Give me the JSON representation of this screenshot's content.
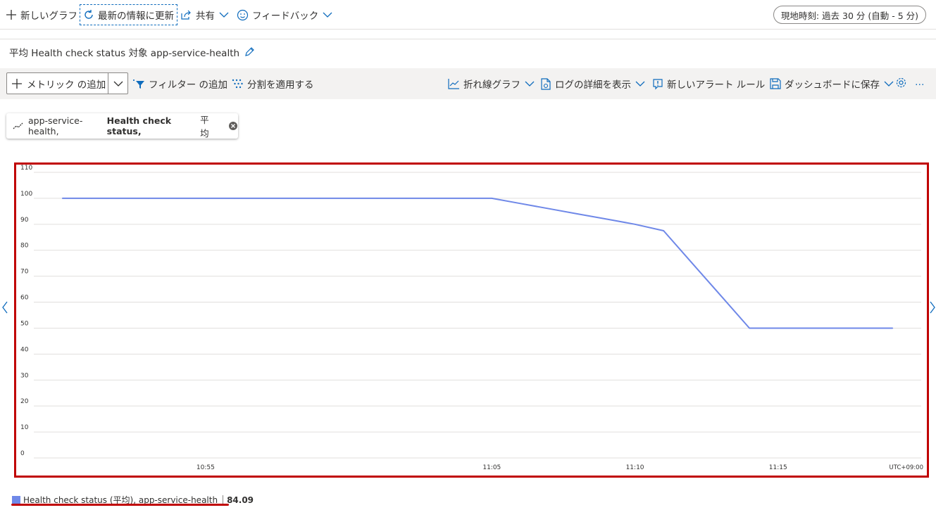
{
  "command_bar": {
    "new_chart": "新しいグラフ",
    "refresh": "最新の情報に更新",
    "share": "共有",
    "feedback": "フィードバック",
    "time_range": "現地時刻: 過去 30 分 (自動 - 5 分)"
  },
  "chart_title": "平均 Health check status 対象 app-service-health",
  "toolbar": {
    "add_metric": "メトリック の追加",
    "add_filter": "フィルター の追加",
    "apply_split": "分割を適用する",
    "line_chart": "折れ線グラフ",
    "show_log_details": "ログの詳細を表示",
    "new_alert_rule": "新しいアラート ルール",
    "save_to_dashboard": "ダッシュボードに保存",
    "more": "…"
  },
  "metric_pill": {
    "resource": "app-service-health,",
    "metric": "Health check status,",
    "aggregation": "平均"
  },
  "legend": {
    "label": "Health check status (平均), app-service-health",
    "value": "84.09"
  },
  "colors": {
    "series": "#6f88e8",
    "highlight": "#c00000",
    "accent": "#0f6cbd"
  },
  "chart_data": {
    "type": "line",
    "timezone_label": "UTC+09:00",
    "x_ticks": [
      "10:55",
      "11:05",
      "11:10",
      "11:15"
    ],
    "ylim": [
      0,
      110
    ],
    "y_ticks": [
      0,
      10,
      20,
      30,
      40,
      50,
      60,
      70,
      80,
      90,
      100,
      110
    ],
    "series": [
      {
        "name": "Health check status (平均), app-service-health",
        "x": [
          "10:50",
          "10:51",
          "10:52",
          "10:53",
          "10:54",
          "10:55",
          "10:56",
          "10:57",
          "10:58",
          "10:59",
          "11:00",
          "11:01",
          "11:02",
          "11:03",
          "11:04",
          "11:05",
          "11:06",
          "11:07",
          "11:08",
          "11:09",
          "11:10",
          "11:11",
          "11:12",
          "11:13",
          "11:14",
          "11:15",
          "11:16",
          "11:17",
          "11:18",
          "11:19"
        ],
        "values": [
          100,
          100,
          100,
          100,
          100,
          100,
          100,
          100,
          100,
          100,
          100,
          100,
          100,
          100,
          100,
          100,
          98,
          96,
          94,
          92,
          90,
          87.5,
          75,
          62.5,
          50,
          50,
          50,
          50,
          50,
          50
        ]
      }
    ]
  }
}
